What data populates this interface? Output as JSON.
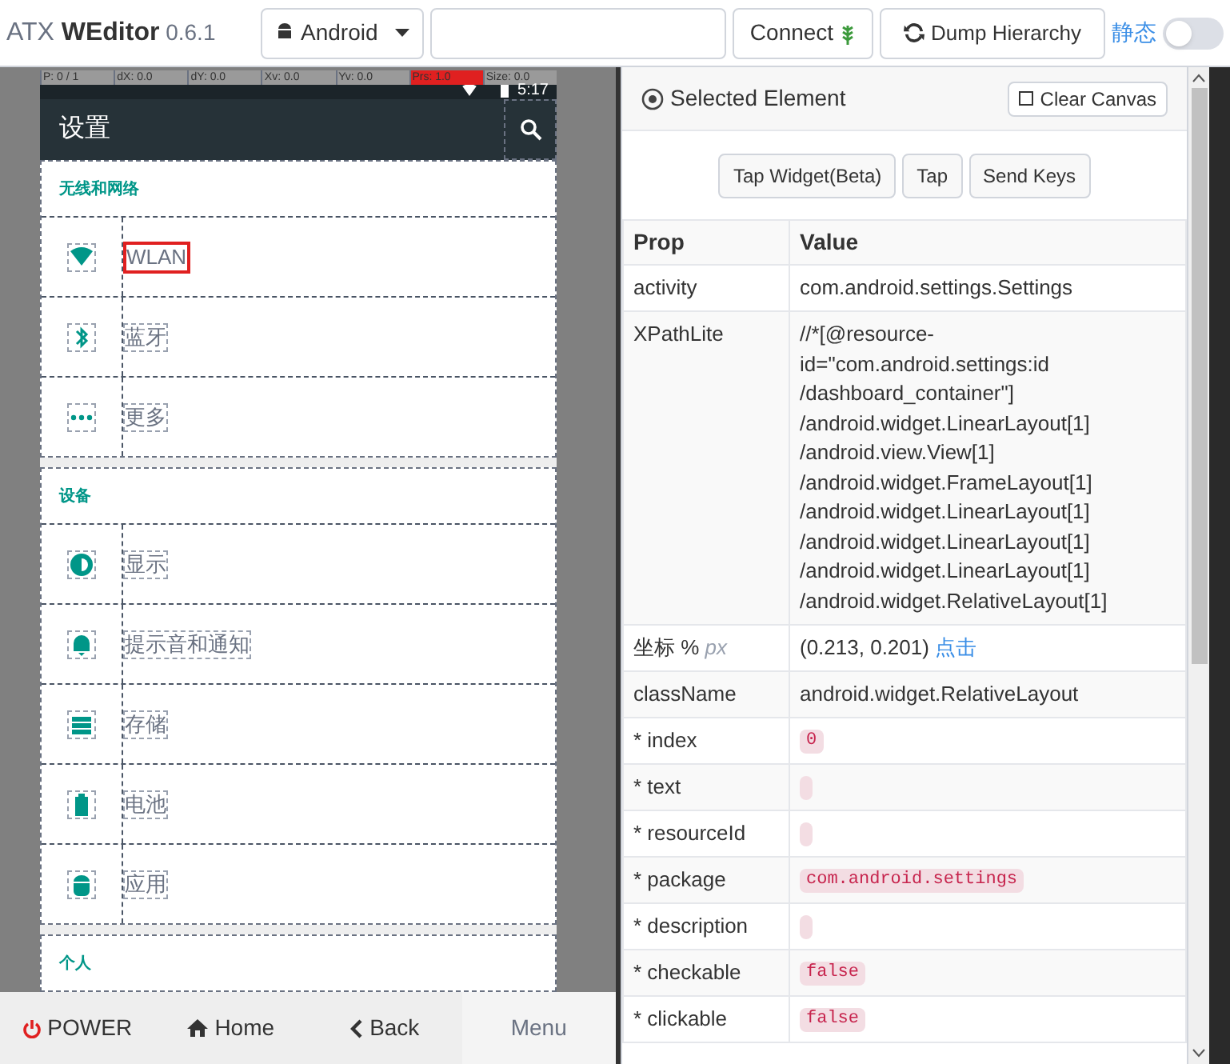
{
  "app": {
    "title": "ATX",
    "title_bold": "WEditor",
    "version": "0.6.1"
  },
  "toolbar": {
    "platform": "Android",
    "connect": "Connect",
    "dump": "Dump Hierarchy",
    "static_label": "静态",
    "static_on": false
  },
  "phone": {
    "overlay": [
      "P: 0 / 1",
      "dX: 0.0",
      "dY: 0.0",
      "Xv: 0.0",
      "Yv: 0.0",
      "Prs: 1.0",
      "Size: 0.0"
    ],
    "time": "5:17",
    "title": "设置",
    "sections": [
      {
        "header": "无线和网络",
        "items": [
          {
            "label": "WLAN",
            "selected": true
          },
          {
            "label": "蓝牙",
            "selected": false
          },
          {
            "label": "更多",
            "selected": false
          }
        ]
      },
      {
        "header": "设备",
        "items": [
          {
            "label": "显示",
            "selected": false
          },
          {
            "label": "提示音和通知",
            "selected": false
          },
          {
            "label": "存储",
            "selected": false
          },
          {
            "label": "电池",
            "selected": false
          },
          {
            "label": "应用",
            "selected": false
          }
        ]
      },
      {
        "header": "个人"
      }
    ]
  },
  "nav": [
    {
      "kind": "power",
      "label": "POWER"
    },
    {
      "kind": "home",
      "label": "Home"
    },
    {
      "kind": "back",
      "label": "Back"
    },
    {
      "kind": "menu",
      "label": "Menu"
    }
  ],
  "inspector": {
    "title": "Selected Element",
    "clear": "Clear Canvas",
    "actions": [
      "Tap Widget(Beta)",
      "Tap",
      "Send Keys"
    ],
    "columns": [
      "Prop",
      "Value"
    ],
    "rows": [
      {
        "kind": "text",
        "prop": "activity",
        "value": "com.android.settings.Settings"
      },
      {
        "kind": "lines",
        "prop": "XPathLite",
        "lines": [
          "//*[@resource-",
          "id=\"com.android.settings:id",
          "/dashboard_container\"]",
          "/android.widget.LinearLayout[1]",
          "/android.view.View[1]",
          "/android.widget.FrameLayout[1]",
          "/android.widget.LinearLayout[1]",
          "/android.widget.LinearLayout[1]",
          "/android.widget.LinearLayout[1]",
          "/android.widget.RelativeLayout[1]"
        ]
      },
      {
        "kind": "coord",
        "prop": "坐标 % *px*",
        "value": "(0.213, 0.201)",
        "link": "点击"
      },
      {
        "kind": "text",
        "prop": "className",
        "value": "android.widget.RelativeLayout"
      },
      {
        "kind": "code",
        "prop": "* index",
        "value": "0"
      },
      {
        "kind": "code",
        "prop": "* text"
      },
      {
        "kind": "code",
        "prop": "* resourceId"
      },
      {
        "kind": "code",
        "prop": "* package",
        "value": "com.android.settings"
      },
      {
        "kind": "code",
        "prop": "* description"
      },
      {
        "kind": "code",
        "prop": "* checkable",
        "value": "false"
      },
      {
        "kind": "code",
        "prop": "* clickable",
        "value": "false"
      }
    ]
  }
}
